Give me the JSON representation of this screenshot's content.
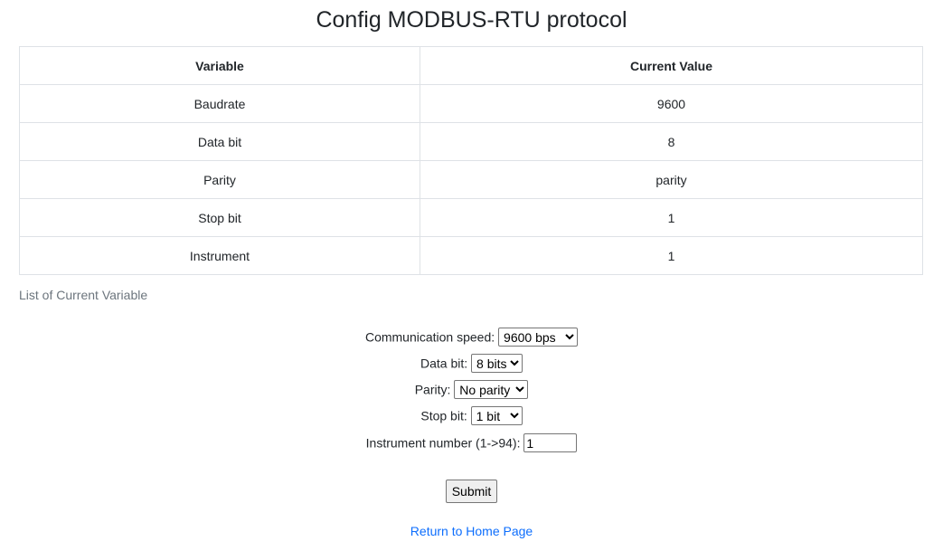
{
  "title": "Config MODBUS-RTU protocol",
  "table": {
    "headers": [
      "Variable",
      "Current Value"
    ],
    "rows": [
      {
        "variable": "Baudrate",
        "value": "9600"
      },
      {
        "variable": "Data bit",
        "value": "8"
      },
      {
        "variable": "Parity",
        "value": "parity"
      },
      {
        "variable": "Stop bit",
        "value": "1"
      },
      {
        "variable": "Instrument",
        "value": "1"
      }
    ],
    "caption": "List of Current Variable"
  },
  "form": {
    "speed": {
      "label": "Communication speed:",
      "selected": "9600 bps"
    },
    "data_bit": {
      "label": "Data bit:",
      "selected": "8 bits"
    },
    "parity": {
      "label": "Parity:",
      "selected": "No parity"
    },
    "stop_bit": {
      "label": "Stop bit:",
      "selected": "1 bit"
    },
    "instrument": {
      "label": "Instrument number (1->94):",
      "value": "1"
    },
    "submit_label": "Submit"
  },
  "home_link": "Return to Home Page"
}
